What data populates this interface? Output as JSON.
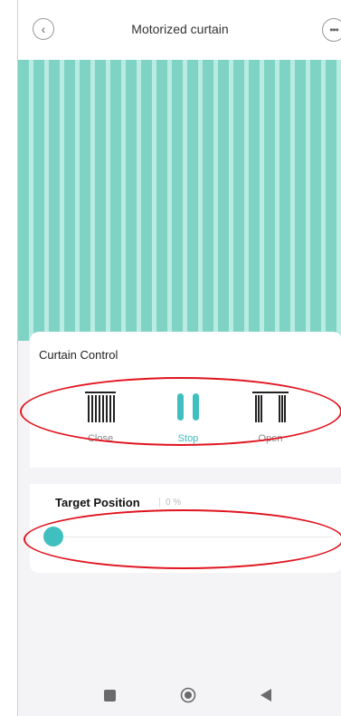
{
  "header": {
    "title": "Motorized curtain",
    "back_icon": "chevron-left-icon",
    "more_icon": "ellipsis-icon"
  },
  "curtain_color": "#8fd9cb",
  "curtain_control": {
    "title": "Curtain Control",
    "buttons": [
      {
        "label": "Close",
        "icon": "curtain-closed-icon"
      },
      {
        "label": "Stop",
        "icon": "pause-icon",
        "active": true
      },
      {
        "label": "Open",
        "icon": "curtain-open-icon"
      }
    ]
  },
  "target_position": {
    "label": "Target Position",
    "value": "0 %",
    "slider_value": 0
  },
  "accent_color": "#3fbfbf",
  "annotation_color": "#e0141e",
  "nav": {
    "icons": [
      "square-icon",
      "circle-icon",
      "triangle-back-icon"
    ]
  }
}
